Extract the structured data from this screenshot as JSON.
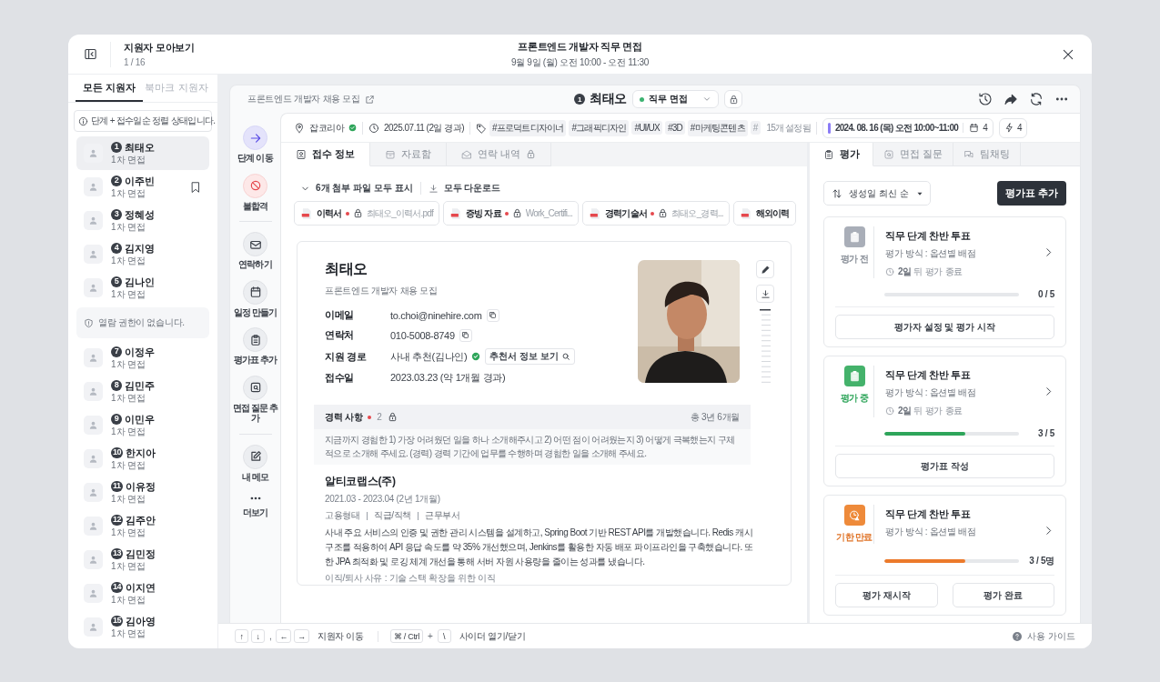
{
  "header": {
    "title": "지원자 모아보기",
    "count": "1 / 16",
    "event_title": "프론트엔드 개발자 직무 면접",
    "event_time": "9월 9일 (월) 오전 10:00 - 오전 11:30"
  },
  "sidebar": {
    "tabs": [
      {
        "label": "모든 지원자",
        "selected": true
      },
      {
        "label": "북마크 지원자",
        "selected": false
      }
    ],
    "notice": "단계 + 접수일순 정렬 상태입니다.",
    "items": [
      {
        "kind": "applicant",
        "number": "1",
        "name": "최태오",
        "stage": "1차 면접",
        "selected": true,
        "bookmarked": false
      },
      {
        "kind": "applicant",
        "number": "2",
        "name": "이주빈",
        "stage": "1차 면접",
        "selected": false,
        "bookmarked": true
      },
      {
        "kind": "applicant",
        "number": "3",
        "name": "정혜성",
        "stage": "1차 면접",
        "selected": false,
        "bookmarked": false
      },
      {
        "kind": "applicant",
        "number": "4",
        "name": "김지영",
        "stage": "1차 면접",
        "selected": false,
        "bookmarked": false
      },
      {
        "kind": "applicant",
        "number": "5",
        "name": "김나인",
        "stage": "1차 면접",
        "selected": false,
        "bookmarked": false
      },
      {
        "kind": "restricted",
        "message": "열람 권한이 없습니다."
      },
      {
        "kind": "applicant",
        "number": "7",
        "name": "이정우",
        "stage": "1차 면접",
        "selected": false,
        "bookmarked": false
      },
      {
        "kind": "applicant",
        "number": "8",
        "name": "김민주",
        "stage": "1차 면접",
        "selected": false,
        "bookmarked": false
      },
      {
        "kind": "applicant",
        "number": "9",
        "name": "이민우",
        "stage": "1차 면접",
        "selected": false,
        "bookmarked": false
      },
      {
        "kind": "applicant",
        "number": "10",
        "name": "한지아",
        "stage": "1차 면접",
        "selected": false,
        "bookmarked": false
      },
      {
        "kind": "applicant",
        "number": "11",
        "name": "이유정",
        "stage": "1차 면접",
        "selected": false,
        "bookmarked": false
      },
      {
        "kind": "applicant",
        "number": "12",
        "name": "김주안",
        "stage": "1차 면접",
        "selected": false,
        "bookmarked": false
      },
      {
        "kind": "applicant",
        "number": "13",
        "name": "김민정",
        "stage": "1차 면접",
        "selected": false,
        "bookmarked": false
      },
      {
        "kind": "applicant",
        "number": "14",
        "name": "이지연",
        "stage": "1차 면접",
        "selected": false,
        "bookmarked": false
      },
      {
        "kind": "applicant",
        "number": "15",
        "name": "김아영",
        "stage": "1차 면접",
        "selected": false,
        "bookmarked": false
      }
    ]
  },
  "panel": {
    "posting": "프론트엔드 개발자 채용 모집",
    "applicant_number": "1",
    "applicant_name": "최태오",
    "stage": "직무 면접",
    "info": {
      "source": "잡코리아",
      "source_verified": true,
      "date": "2025.07.11 (2일 경과)",
      "tags": [
        {
          "label": "#프로덕트디자이너",
          "faded": false
        },
        {
          "label": "#그래픽디자인",
          "faded": false
        },
        {
          "label": "#UI/UX",
          "faded": false
        },
        {
          "label": "#3D",
          "faded": false
        },
        {
          "label": "#마케팅콘텐츠",
          "faded": false
        },
        {
          "label": "#",
          "faded": true
        }
      ],
      "tag_count": "15개 설정됨",
      "schedule": "2024. 08. 16 (목) 오전 10:00~11:00",
      "schedule_count": "4",
      "action_count": "4"
    },
    "actions": [
      {
        "kind": "primary",
        "label": "단계 이동"
      },
      {
        "kind": "danger",
        "label": "불합격"
      },
      {
        "kind": "divider"
      },
      {
        "kind": "normal",
        "label": "연락하기"
      },
      {
        "kind": "normal",
        "label": "일정 만들기"
      },
      {
        "kind": "normal",
        "label": "평가표 추가"
      },
      {
        "kind": "normal",
        "label": "면접 질문 추가"
      },
      {
        "kind": "divider"
      },
      {
        "kind": "normal",
        "label": "내 메모"
      },
      {
        "kind": "plain",
        "label": "더보기"
      }
    ],
    "doc_tabs": [
      {
        "label": "접수 정보",
        "selected": true,
        "locked": false
      },
      {
        "label": "자료함",
        "selected": false,
        "locked": false
      },
      {
        "label": "연락 내역",
        "selected": false,
        "locked": true
      }
    ],
    "attachments": {
      "toggle": "6개 첨부 파일 모두 표시",
      "download": "모두 다운로드",
      "files": [
        {
          "label": "이력서",
          "required": true,
          "locked": true,
          "file": "최태오_이력서.pdf"
        },
        {
          "label": "증빙 자료",
          "required": true,
          "locked": true,
          "file": "Work_Certifi..."
        },
        {
          "label": "경력기술서",
          "required": true,
          "locked": true,
          "file": "최태오_경력..."
        },
        {
          "label": "해외이력"
        }
      ]
    },
    "profile": {
      "name": "최태오",
      "posting": "프론트엔드 개발자 채용 모집",
      "fields": [
        {
          "kind": "copy",
          "label": "이메일",
          "value": "to.choi@ninehire.com"
        },
        {
          "kind": "copy",
          "label": "연락처",
          "value": "010-5008-8749"
        },
        {
          "kind": "referral",
          "label": "지원 경로",
          "value": "사내 추천(김나인)",
          "verified": true,
          "link": "추천서 정보 보기"
        },
        {
          "kind": "plain",
          "label": "접수일",
          "value": "2023.03.23 (약 1개월 경과)"
        }
      ]
    },
    "career": {
      "title": "경력 사항",
      "required": true,
      "count": "2",
      "total": "총 3년 6개월",
      "question": "지금까지 경험한 1) 가장 어려웠던 일을 하나 소개해주시고 2) 어떤 점이 어려웠는지 3) 어떻게 극복했는지 구체적으로 소개해 주세요. (경력) 경력 기간에 업무를 수행하며 경험한 일을 소개해 주세요.",
      "entries": [
        {
          "company": "알티코랩스(주)",
          "period": "2021.03 - 2023.04 (2년 1개월)",
          "meta": [
            "고용형태",
            "직급/직책",
            "근무부서"
          ],
          "description": "사내 주요 서비스의 인증 및 권한 관리 시스템을 설계하고, Spring Boot 기반 REST API를 개발했습니다. Redis 캐시 구조를 적용하여 API 응답 속도를 약 35% 개선했으며, Jenkins를 활용한 자동 배포 파이프라인을 구축했습니다. 또한 JPA 최적화 및 로깅 체계 개선을 통해 서버 자원 사용량을 줄이는 성과를 냈습니다.",
          "reason": "이직/퇴사 사유 : 기술 스택 확장을 위한 이직"
        }
      ]
    },
    "evaluation": {
      "tabs": [
        {
          "label": "평가",
          "selected": true
        },
        {
          "label": "면접 질문",
          "selected": false
        },
        {
          "label": "팀채팅",
          "selected": false
        }
      ],
      "sort": "생성일 최신 순",
      "add_button": "평가표 추가",
      "cards": [
        {
          "kind": "before",
          "status_label": "평가 전",
          "title": "직무 단계 찬반 투표",
          "method": "평가 방식 : 옵션별 배점",
          "deadline": "**2일** 뒤 평가 종료",
          "level": 0,
          "count": "0 / 5",
          "buttons": [
            "평가자 설정 및 평가 시작"
          ]
        },
        {
          "kind": "progress",
          "status_label": "평가 중",
          "title": "직무 단계 찬반 투표",
          "method": "평가 방식 : 옵션별 배점",
          "deadline": "**2일** 뒤 평가 종료",
          "level": 0.6,
          "count": "3 / 5",
          "buttons": [
            "평가표 작성"
          ]
        },
        {
          "kind": "expired",
          "status_label": "기한 만료",
          "title": "직무 단계 찬반 투표",
          "method": "평가 방식 : 옵션별 배점",
          "level": 0.6,
          "count": "3 / 5명",
          "buttons": [
            "평가 재시작",
            "평가 완료"
          ]
        }
      ]
    }
  },
  "footer": {
    "shortcuts": [
      {
        "kind": "key",
        "text": "↑"
      },
      {
        "kind": "key",
        "text": "↓"
      },
      {
        "kind": "sep",
        "text": ","
      },
      {
        "kind": "key",
        "text": "←"
      },
      {
        "kind": "key",
        "text": "→"
      },
      {
        "kind": "label",
        "text": "지원자 이동"
      },
      {
        "kind": "divider"
      },
      {
        "kind": "key",
        "text": "⌘ / Ctrl"
      },
      {
        "kind": "sep",
        "text": "+"
      },
      {
        "kind": "key",
        "text": "\\"
      },
      {
        "kind": "label",
        "text": "사이더 열기/닫기"
      }
    ],
    "guide": "사용 가이드"
  }
}
